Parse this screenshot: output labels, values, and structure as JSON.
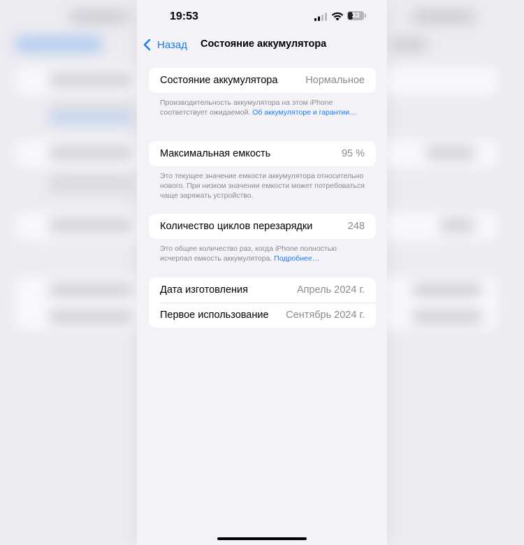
{
  "status_bar": {
    "time": "19:53",
    "battery_level": "33",
    "battery_fraction": 0.33
  },
  "nav": {
    "back_label": "Назад",
    "title": "Состояние аккумулятора"
  },
  "battery_health": {
    "label": "Состояние аккумулятора",
    "value": "Нормальное",
    "note": "Производительность аккумулятора на этом iPhone соответствует ожидаемой.",
    "link_text": "Об аккумуляторе и гарантии…"
  },
  "max_capacity": {
    "label": "Максимальная емкость",
    "value": "95 %",
    "note": "Это текущее значение емкости аккумулятора относительно нового. При низком значении емкости может потребоваться чаще заряжать устройство."
  },
  "cycle_count": {
    "label": "Количество циклов перезарядки",
    "value": "248",
    "note": "Это общее количество раз, когда iPhone полностью исчерпал емкость аккумулятора.",
    "link_text": "Подробнее…"
  },
  "dates": {
    "manufacture_label": "Дата изготовления",
    "manufacture_value": "Апрель 2024 г.",
    "first_use_label": "Первое использование",
    "first_use_value": "Сентябрь 2024 г."
  },
  "colors": {
    "accent": "#1a7cf2",
    "background": "#f2f2f7",
    "secondary_text": "#8a8a8e"
  }
}
